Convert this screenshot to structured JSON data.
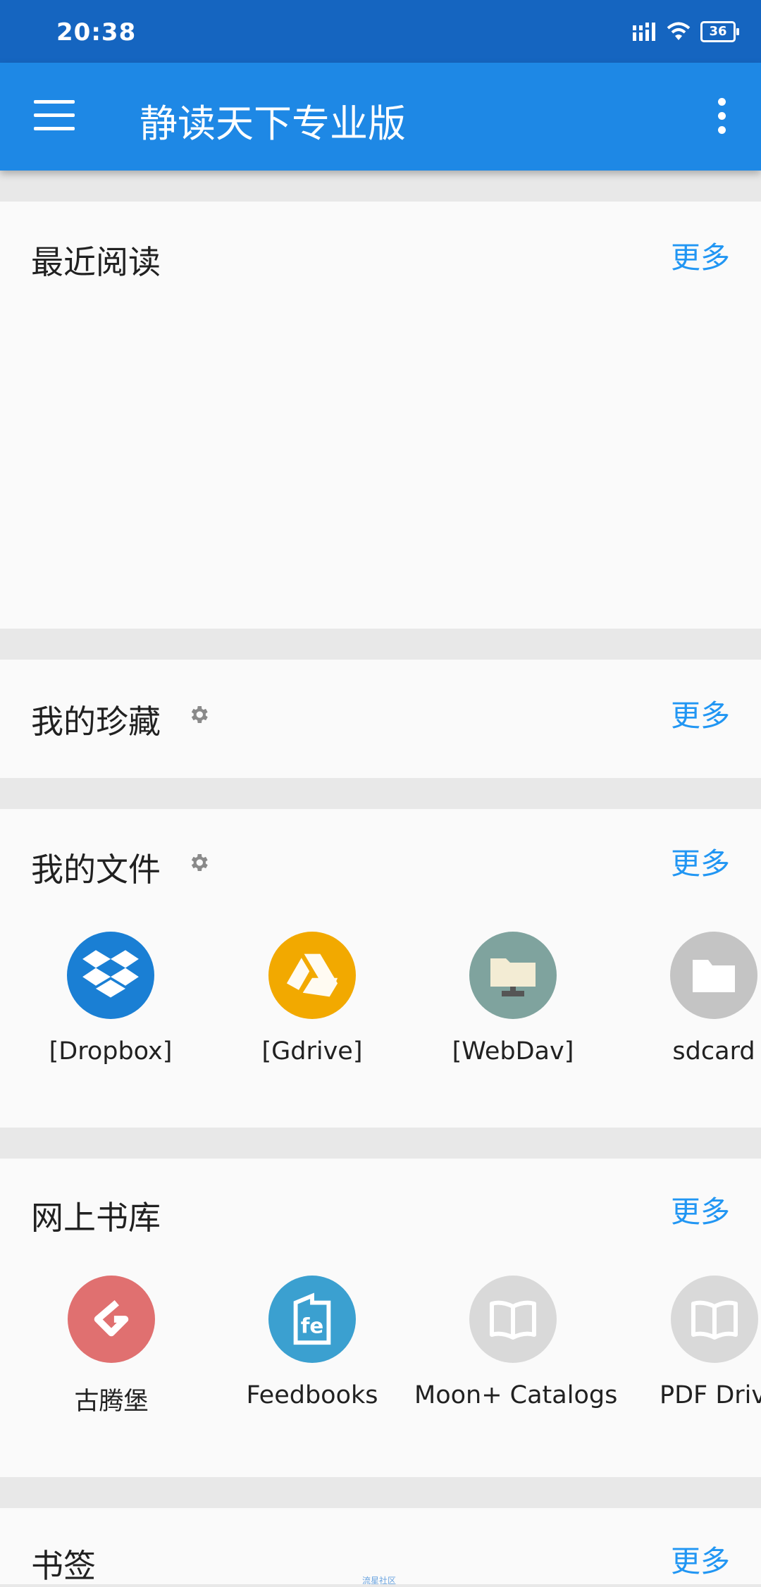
{
  "status_bar": {
    "time": "20:38",
    "battery": "36"
  },
  "app_bar": {
    "title": "静读天下专业版"
  },
  "sections": {
    "recent": {
      "title": "最近阅读",
      "more": "更多"
    },
    "favorites": {
      "title": "我的珍藏",
      "more": "更多"
    },
    "files": {
      "title": "我的文件",
      "more": "更多",
      "items": [
        {
          "label": "[Dropbox]",
          "icon": "dropbox-icon",
          "color": "#1a7fd4"
        },
        {
          "label": "[Gdrive]",
          "icon": "google-drive-icon",
          "color": "#f2a900"
        },
        {
          "label": "[WebDav]",
          "icon": "network-folder-icon",
          "color": "#7fa39e"
        },
        {
          "label": "sdcard",
          "icon": "folder-icon",
          "color": "#c4c4c4"
        }
      ]
    },
    "online": {
      "title": "网上书库",
      "more": "更多",
      "items": [
        {
          "label": "古腾堡",
          "icon": "gutenberg-icon",
          "color": "#e07070"
        },
        {
          "label": "Feedbooks",
          "icon": "feedbooks-icon",
          "color": "#3ba0d0"
        },
        {
          "label": "Moon+ Catalogs",
          "icon": "book-icon",
          "color": "#d9d9d9"
        },
        {
          "label": "PDF Drive",
          "icon": "book-icon",
          "color": "#d9d9d9"
        }
      ]
    },
    "bookmarks": {
      "title": "书签",
      "more": "更多"
    }
  },
  "watermark": "流星社区"
}
